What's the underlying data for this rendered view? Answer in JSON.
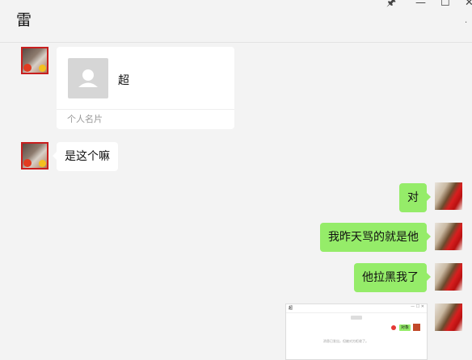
{
  "header": {
    "title": "雷",
    "controls": {
      "pin_icon": "pin-icon",
      "minimize_icon": "minimize-icon",
      "maximize_icon": "maximize-icon",
      "close_icon": "close-icon",
      "more_icon": "more-icon"
    }
  },
  "messages": [
    {
      "side": "left",
      "type": "contact_card",
      "name": "超",
      "footer": "个人名片"
    },
    {
      "side": "left",
      "type": "text",
      "text": "是这个嘛"
    },
    {
      "side": "right",
      "type": "text",
      "text": "对"
    },
    {
      "side": "right",
      "type": "text",
      "text": "我昨天骂的就是他"
    },
    {
      "side": "right",
      "type": "text",
      "text": "他拉黑我了"
    },
    {
      "side": "right",
      "type": "image",
      "image_title": "超",
      "image_green_label": "对象",
      "image_note": "消息已发出，但被对方拒收了。"
    }
  ],
  "colors": {
    "background": "#f3f3f3",
    "outgoing_bubble": "#95ec69",
    "incoming_bubble": "#ffffff",
    "avatar_border": "#c81e1e"
  }
}
